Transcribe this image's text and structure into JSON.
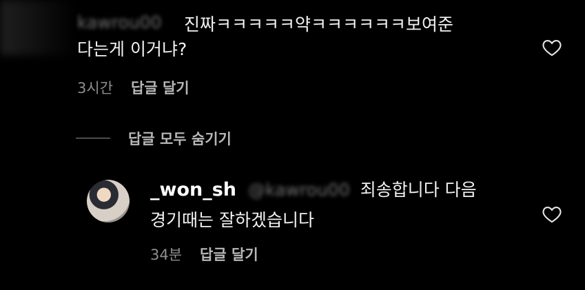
{
  "comment1": {
    "username_blurred": "kawrou00",
    "text": "진짜ㅋㅋㅋㅋㅋ약ㅋㅋㅋㅋㅋㅋ보여준\n다는게 이거냐?",
    "time": "3시간",
    "reply_label": "답글 달기"
  },
  "replies_toggle": {
    "label": "답글 모두 숨기기"
  },
  "reply1": {
    "username": "_won_sh",
    "mention_blurred": "@kawrou00",
    "text_line1": "죄송합니다 다음",
    "text_line2": "경기때는 잘하겠습니다",
    "time": "34분",
    "reply_label": "답글 달기"
  },
  "colors": {
    "background": "#000000",
    "text": "#f2f2f2",
    "meta": "#8e8e8e"
  }
}
